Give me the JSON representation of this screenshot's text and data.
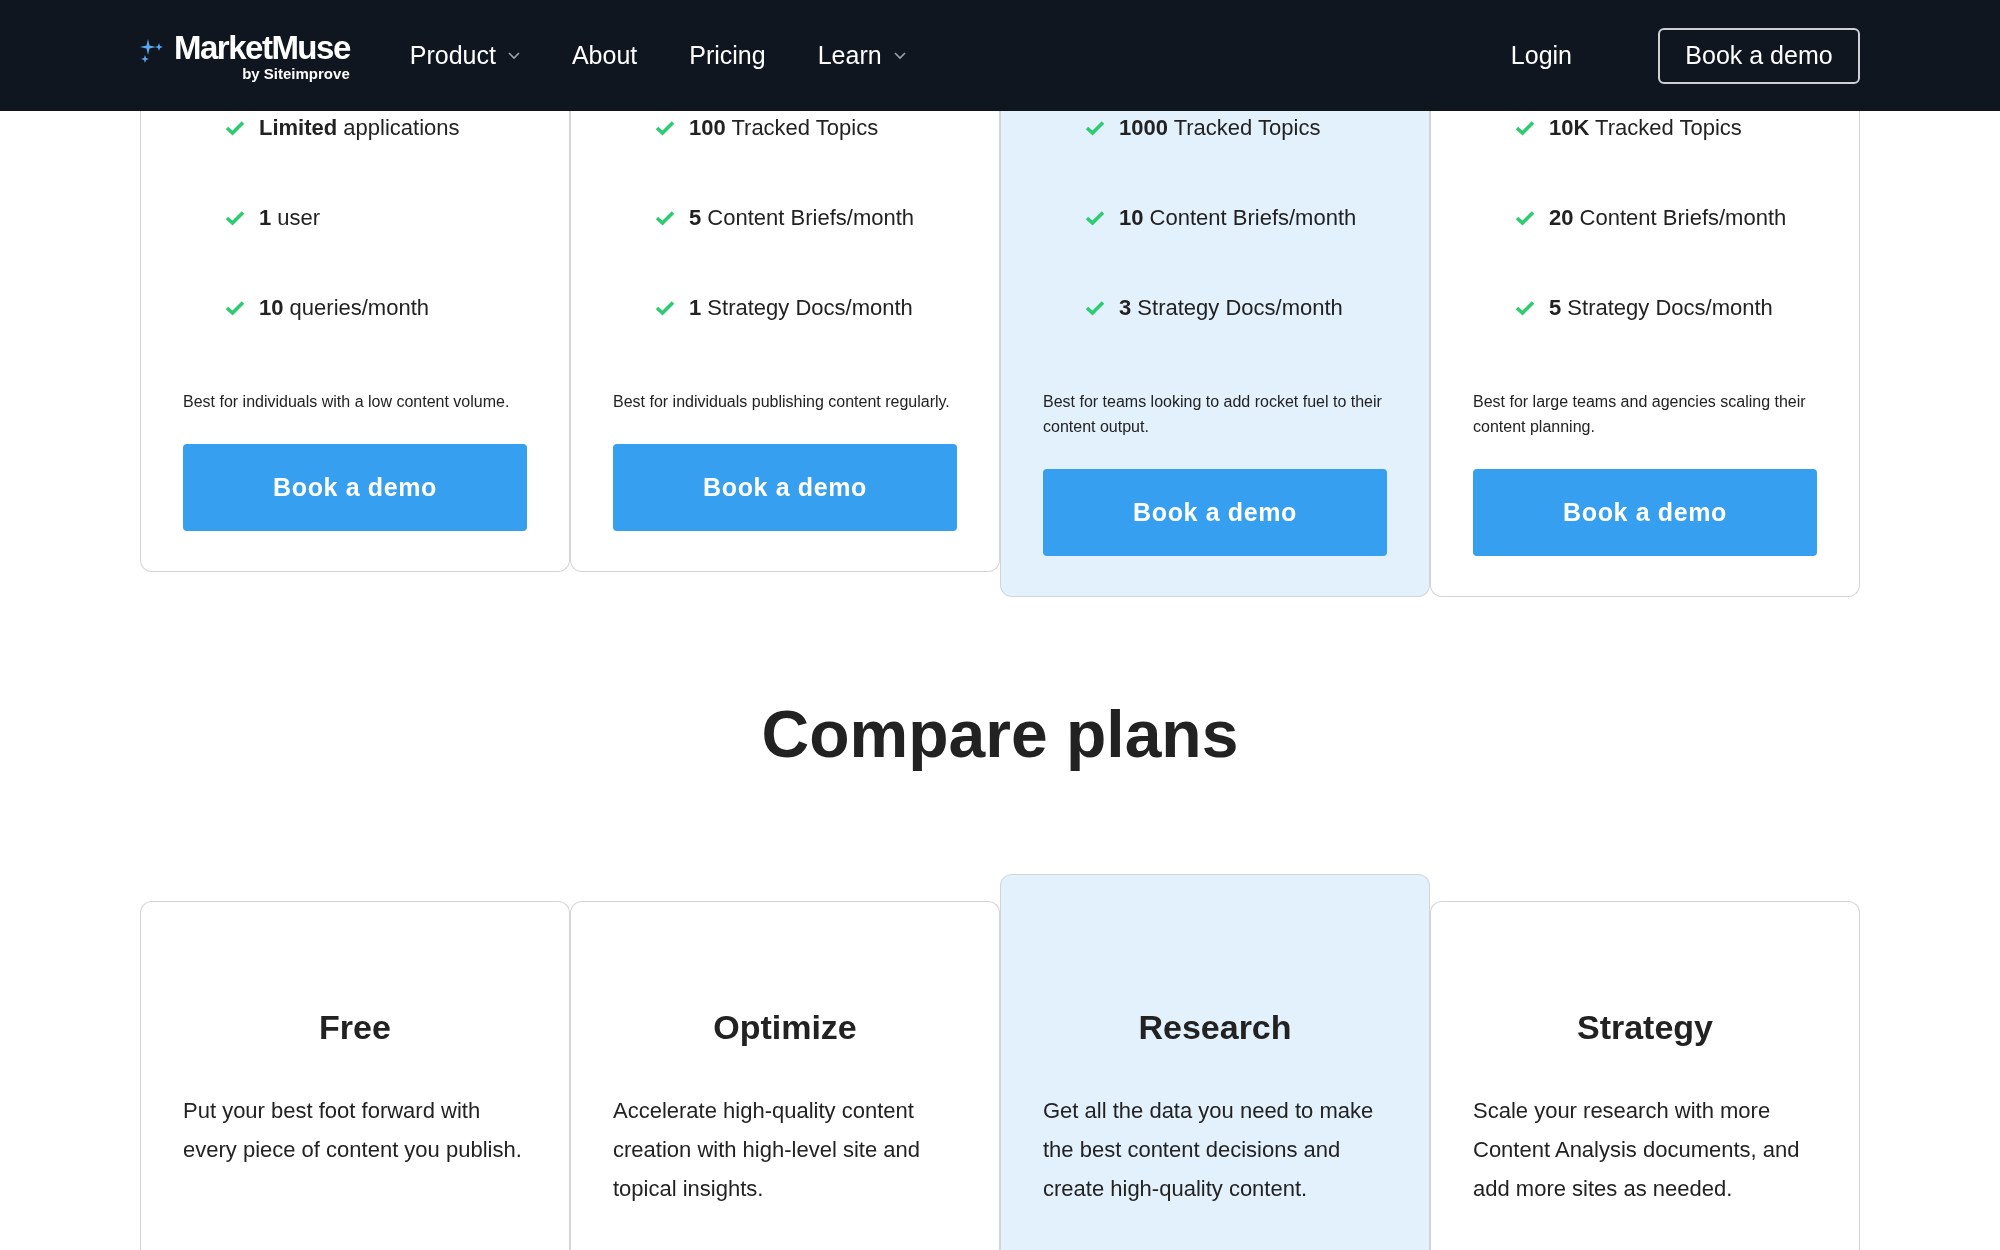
{
  "header": {
    "logo": {
      "name": "MarketMuse",
      "tagline": "by Siteimprove"
    },
    "nav": [
      {
        "label": "Product",
        "dropdown": true
      },
      {
        "label": "About",
        "dropdown": false
      },
      {
        "label": "Pricing",
        "dropdown": false
      },
      {
        "label": "Learn",
        "dropdown": true
      }
    ],
    "login": "Login",
    "cta": "Book a demo"
  },
  "plan_cards": [
    {
      "highlighted": false,
      "features": [
        "**Limited** applications",
        "**1** user",
        "**10** queries/month"
      ],
      "description": "Best for individuals with a low content volume.",
      "button": "Book a demo"
    },
    {
      "highlighted": false,
      "features": [
        "**100** Tracked Topics",
        "**5** Content Briefs/month",
        "**1** Strategy Docs/month"
      ],
      "description": "Best for individuals publishing content regularly.",
      "button": "Book a demo"
    },
    {
      "highlighted": true,
      "features": [
        "**1000** Tracked Topics",
        "**10** Content Briefs/month",
        "**3** Strategy Docs/month"
      ],
      "description": "Best for teams looking to add rocket fuel to their content output.",
      "button": "Book a demo"
    },
    {
      "highlighted": false,
      "features": [
        "**10K** Tracked Topics",
        "**20** Content Briefs/month",
        "**5** Strategy Docs/month"
      ],
      "description": "Best for large teams and agencies scaling their content planning.",
      "button": "Book a demo"
    }
  ],
  "compare": {
    "title": "Compare plans",
    "plans": [
      {
        "name": "Free",
        "highlighted": false,
        "description": "Put your best foot forward with every piece of content you publish."
      },
      {
        "name": "Optimize",
        "highlighted": false,
        "description": "Accelerate high-quality content creation with high-level site and topical insights."
      },
      {
        "name": "Research",
        "highlighted": true,
        "description": "Get all the data you need to make the best content decisions and create high-quality content."
      },
      {
        "name": "Strategy",
        "highlighted": false,
        "description": "Scale your research with more Content Analysis documents, and add more sites as needed."
      }
    ]
  }
}
